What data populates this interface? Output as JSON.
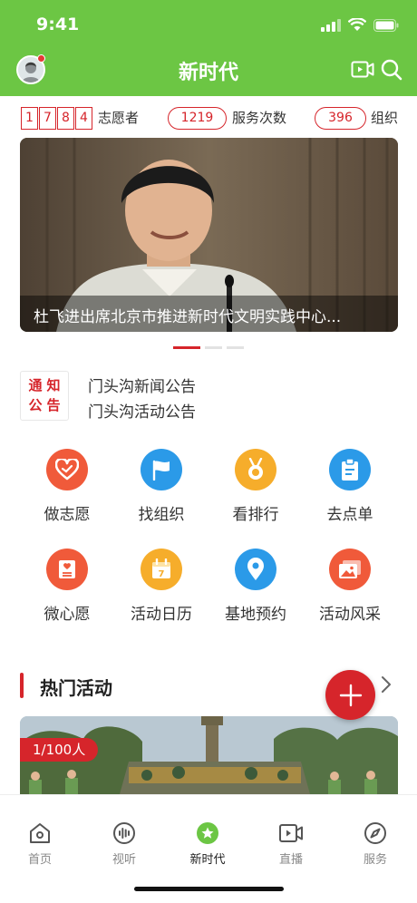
{
  "status": {
    "time": "9:41"
  },
  "header": {
    "title": "新时代"
  },
  "stats": {
    "volunteer_digits": [
      "1",
      "7",
      "8",
      "4"
    ],
    "volunteer_label": "志愿者",
    "service_count": "1219",
    "service_label": "服务次数",
    "org_count": "396",
    "org_label": "组织"
  },
  "banner": {
    "caption": "杜飞进出席北京市推进新时代文明实践中心..."
  },
  "notice": {
    "badge": [
      "通知",
      "公告"
    ],
    "items": [
      "门头沟新闻公告",
      "门头沟活动公告"
    ]
  },
  "grid": [
    {
      "label": "做志愿",
      "icon": "heart-icon",
      "color": "#f05a3a"
    },
    {
      "label": "找组织",
      "icon": "flag-icon",
      "color": "#2b9ae8"
    },
    {
      "label": "看排行",
      "icon": "medal-icon",
      "color": "#f6ad2b"
    },
    {
      "label": "去点单",
      "icon": "clipboard-icon",
      "color": "#2b9ae8"
    },
    {
      "label": "微心愿",
      "icon": "wish-card-icon",
      "color": "#f05a3a"
    },
    {
      "label": "活动日历",
      "icon": "calendar-icon",
      "color": "#f6ad2b"
    },
    {
      "label": "基地预约",
      "icon": "location-pin-icon",
      "color": "#2b9ae8"
    },
    {
      "label": "活动风采",
      "icon": "photos-icon",
      "color": "#f05a3a"
    }
  ],
  "calendar_day": "7",
  "hot": {
    "title": "热门活动",
    "tag": "1/100人"
  },
  "tabs": [
    {
      "label": "首页",
      "icon": "home-icon"
    },
    {
      "label": "视听",
      "icon": "audio-icon"
    },
    {
      "label": "新时代",
      "icon": "star-icon"
    },
    {
      "label": "直播",
      "icon": "live-video-icon"
    },
    {
      "label": "服务",
      "icon": "compass-icon"
    }
  ],
  "colors": {
    "brand_green": "#6cc644",
    "accent_red": "#d6252b"
  }
}
